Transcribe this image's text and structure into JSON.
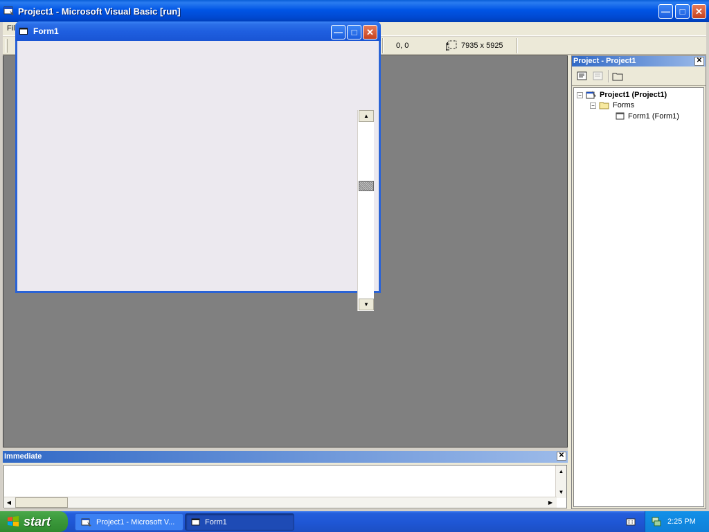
{
  "main_window": {
    "title": "Project1 - Microsoft Visual Basic [run]",
    "menu_first": "Fil",
    "position_readout": "0, 0",
    "size_readout": "7935 x 5925"
  },
  "form1": {
    "title": "Form1"
  },
  "project_explorer": {
    "title": "Project - Project1",
    "tree": {
      "project": "Project1 (Project1)",
      "folder": "Forms",
      "form": "Form1 (Form1)"
    }
  },
  "immediate": {
    "title": "Immediate"
  },
  "taskbar": {
    "start_label": "start",
    "tasks": [
      "Project1 - Microsoft V...",
      "Form1"
    ],
    "clock": "2:25 PM"
  }
}
